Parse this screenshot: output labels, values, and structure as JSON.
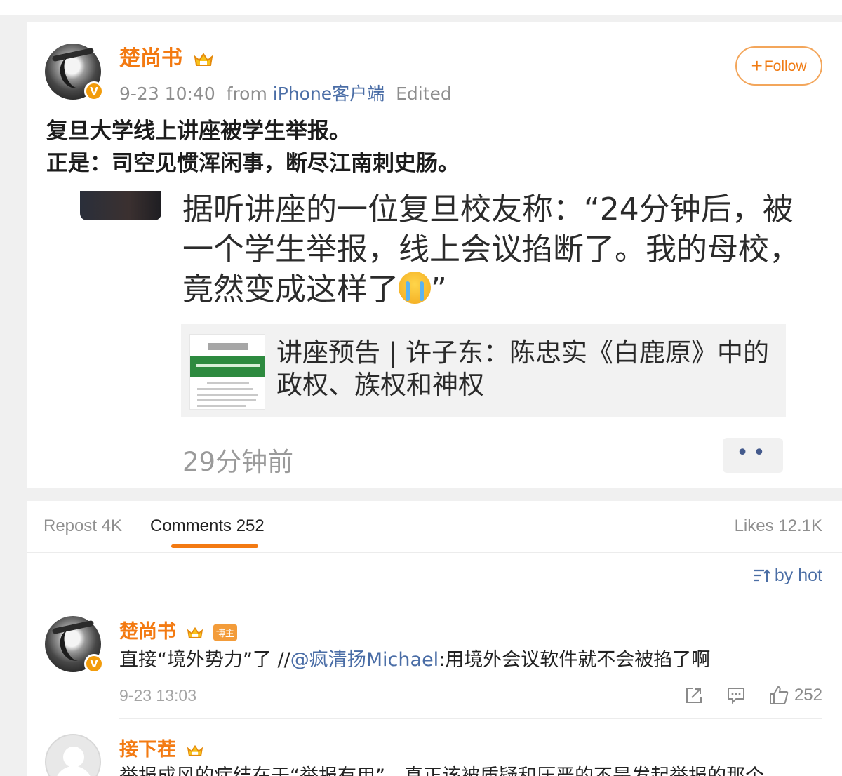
{
  "post": {
    "username": "楚尚书",
    "verified_badge": "V",
    "time": "9-23 10:40",
    "from_prefix": "from",
    "source": "iPhone客户端",
    "edited": "Edited",
    "follow_label": "Follow",
    "text_line1": "复旦大学线上讲座被学生举报。",
    "text_line2": "正是：司空见惯浑闲事，断尽江南刺史肠。",
    "quote": "据听讲座的一位复旦校友称：“24分钟后，被一个学生举报，线上会议掐断了。我的母校，竟然变成这样了",
    "quote_end": "”",
    "emoji": "crying-face",
    "link_title": "讲座预告 | 许子东：陈忠实《白鹿原》中的政权、族权和神权",
    "time_ago": "29分钟前",
    "more_label": "••"
  },
  "tabs": {
    "repost": "Repost 4K",
    "comments": "Comments 252",
    "likes": "Likes 12.1K"
  },
  "sort_label": "by hot",
  "comments": [
    {
      "username": "楚尚书",
      "tag": "博主",
      "text_before": "直接“境外势力”了 //",
      "mention": "@疯清扬Michael",
      "text_after": ":用境外会议软件就不会被掐了啊",
      "time": "9-23 13:03",
      "likes": "252"
    },
    {
      "username": "接下茬",
      "text": "举报成风的症结在于“举报有用”，真正该被质疑和压严的不是发起举报的那个"
    }
  ],
  "colors": {
    "accent": "#f37a12",
    "link": "#4a6da6",
    "muted": "#8e8e8e"
  }
}
